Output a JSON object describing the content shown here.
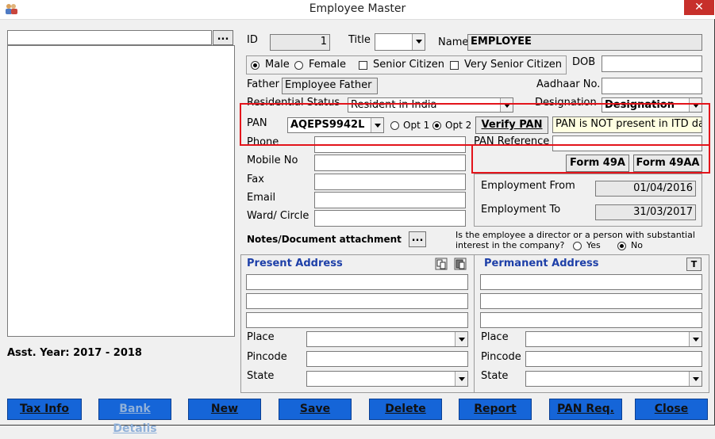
{
  "window": {
    "title": "Employee Master",
    "close_glyph": "✕"
  },
  "left_panel": {
    "search_value": "",
    "browse_label": "...",
    "asst_year": "Asst. Year: 2017 - 2018"
  },
  "form": {
    "id_label": "ID",
    "id_value": "1",
    "title_label": "Title",
    "title_value": "",
    "name_label": "Name",
    "name_value": "EMPLOYEE",
    "gender": {
      "male": "Male",
      "female": "Female",
      "selected": "Male"
    },
    "senior": "Senior Citizen",
    "very_senior": "Very Senior Citizen",
    "dob_label": "DOB",
    "dob_value": "",
    "father_label": "Father",
    "father_value": "Employee Father",
    "aadhaar_label": "Aadhaar No.",
    "aadhaar_value": "",
    "res_status_label": "Residential Status",
    "res_status_value": "Resident in India",
    "designation_label": "Designation",
    "designation_value": "Designation",
    "pan_label": "PAN",
    "pan_value": "AQEPS9942L",
    "opt1": "Opt 1",
    "opt2": "Opt 2",
    "opt_selected": "Opt 2",
    "verify_pan": "Verify PAN",
    "pan_status": "PAN is NOT present in ITD dat",
    "pan_ref_label": "PAN Reference",
    "pan_ref_value": "",
    "phone_label": "Phone",
    "mobile_label": "Mobile No",
    "fax_label": "Fax",
    "email_label": "Email",
    "ward_label": "Ward/ Circle",
    "form49a": "Form 49A",
    "form49aa": "Form 49AA",
    "emp_from_label": "Employment From",
    "emp_from_value": "01/04/2016",
    "emp_to_label": "Employment To",
    "emp_to_value": "31/03/2017",
    "notes_label": "Notes/Document attachment",
    "notes_btn": "...",
    "director_q1": "Is the employee a director or a person with substantial",
    "director_q2": "interest in the company?",
    "yes": "Yes",
    "no": "No",
    "director_selected": "No"
  },
  "present_address": {
    "header": "Present Address",
    "place_label": "Place",
    "pincode_label": "Pincode",
    "state_label": "State"
  },
  "permanent_address": {
    "header": "Permanent Address",
    "t_btn": "T",
    "place_label": "Place",
    "pincode_label": "Pincode",
    "state_label": "State"
  },
  "buttons": {
    "tax_info": "Tax Info",
    "bank_details": "Bank Details",
    "new": "New",
    "save": "Save",
    "delete": "Delete",
    "report": "Report",
    "pan_req": "PAN Req.",
    "close": "Close"
  }
}
